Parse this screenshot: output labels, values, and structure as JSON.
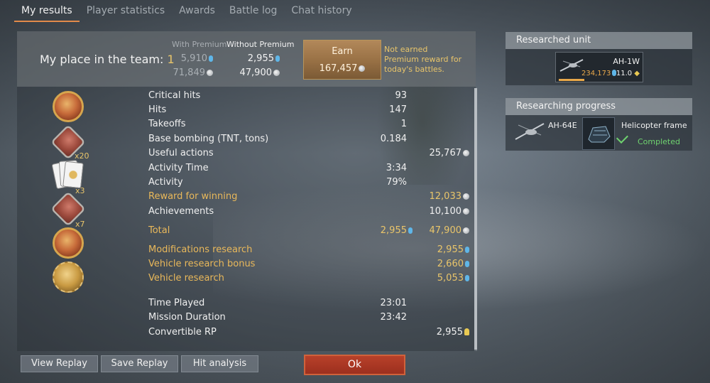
{
  "tabs": [
    "My results",
    "Player statistics",
    "Awards",
    "Battle log",
    "Chat history"
  ],
  "header": {
    "place_label": "My place in the team:",
    "place_value": "1",
    "with_premium_label": "With Premium",
    "without_premium_label": "Without Premium",
    "with_premium_rp": "5,910",
    "with_premium_sl": "71,849",
    "without_premium_rp": "2,955",
    "without_premium_sl": "47,900",
    "earn_label": "Earn",
    "earn_value": "167,457",
    "note": "Not earned Premium reward for today's battles."
  },
  "award_multipliers": [
    "x20",
    "x3",
    "x7"
  ],
  "stats": [
    {
      "label": "Critical hits",
      "v1": "93",
      "v2": ""
    },
    {
      "label": "Hits",
      "v1": "147",
      "v2": ""
    },
    {
      "label": "Takeoffs",
      "v1": "1",
      "v2": ""
    },
    {
      "label": "Base bombing (TNT, tons)",
      "v1": "0.184",
      "v2": ""
    },
    {
      "label": "Useful actions",
      "v1": "",
      "v2": "25,767"
    },
    {
      "label": "Activity Time",
      "v1": "3:34",
      "v2": ""
    },
    {
      "label": "Activity",
      "v1": "79%",
      "v2": ""
    },
    {
      "label": "Reward for winning",
      "v1": "",
      "v2": "12,033"
    },
    {
      "label": "Achievements",
      "v1": "",
      "v2": "10,100"
    },
    {
      "label": "Total",
      "v1": "2,955",
      "v2": "47,900"
    },
    {
      "label": "Modifications research",
      "v1": "",
      "v2": "2,955"
    },
    {
      "label": "Vehicle research bonus",
      "v1": "",
      "v2": "2,660"
    },
    {
      "label": "Vehicle research",
      "v1": "",
      "v2": "5,053"
    },
    {
      "label": "Time Played",
      "v1": "23:01",
      "v2": ""
    },
    {
      "label": "Mission Duration",
      "v1": "23:42",
      "v2": ""
    },
    {
      "label": "Convertible RP",
      "v1": "",
      "v2": "2,955"
    }
  ],
  "buttons": {
    "view_replay": "View Replay",
    "save_replay": "Save Replay",
    "hit_analysis": "Hit analysis",
    "ok": "Ok"
  },
  "researched_unit": {
    "title": "Researched unit",
    "name": "AH-1W",
    "rp": "234,173",
    "br": "11.0"
  },
  "research_progress": {
    "title": "Researching progress",
    "vehicle": "AH-64E",
    "module": "Helicopter frame",
    "status": "Completed"
  },
  "colors": {
    "accent": "#e28a4a",
    "gold": "#e9c56a",
    "ok": "#b8412a",
    "completed": "#6fd36f"
  }
}
